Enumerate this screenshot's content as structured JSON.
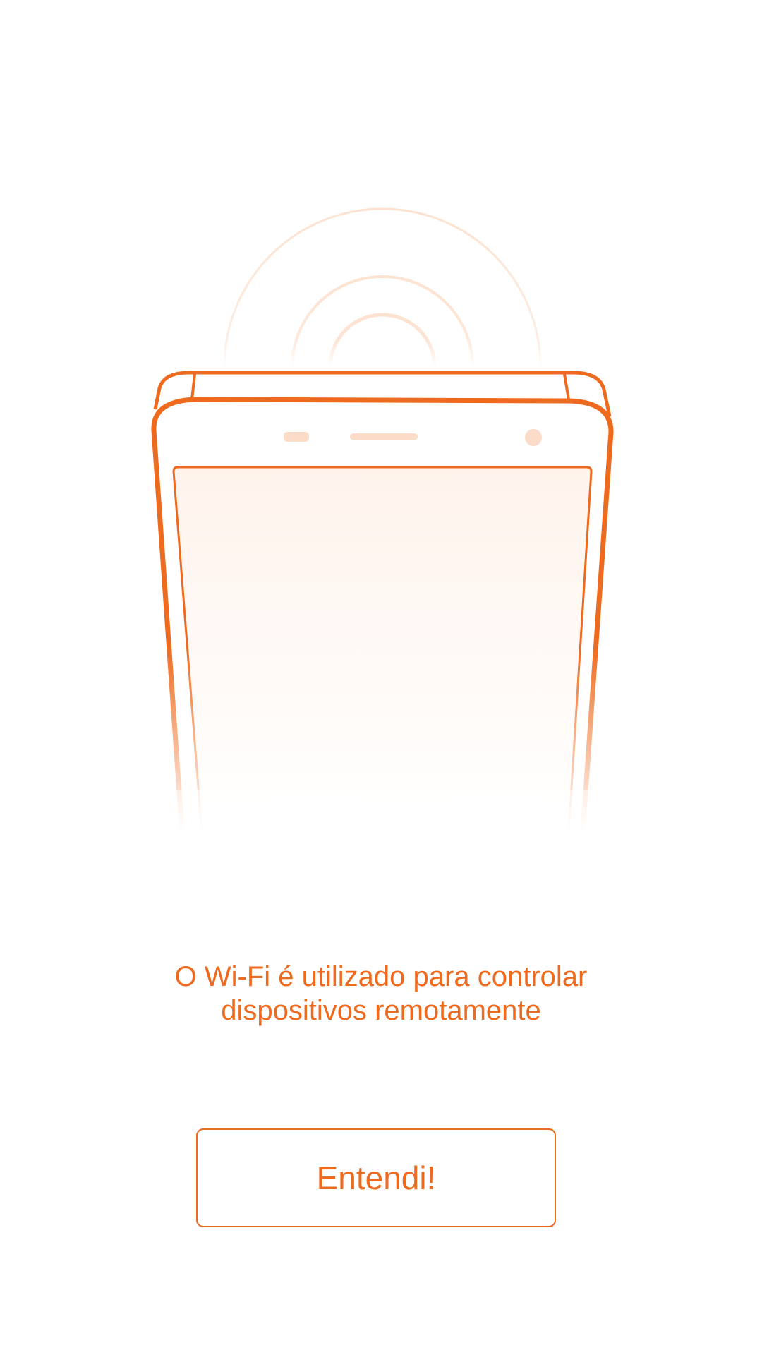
{
  "message": {
    "line1": "O Wi-Fi é utilizado para controlar",
    "line2": "dispositivos remotamente"
  },
  "button": {
    "label": "Entendi!"
  },
  "colors": {
    "accent": "#ee6a1e",
    "accent_light": "#fbd3b8",
    "screen_tint": "#fff5f0",
    "background": "#ffffff"
  },
  "illustration": {
    "icon": "phone-with-wifi-signal-icon"
  }
}
